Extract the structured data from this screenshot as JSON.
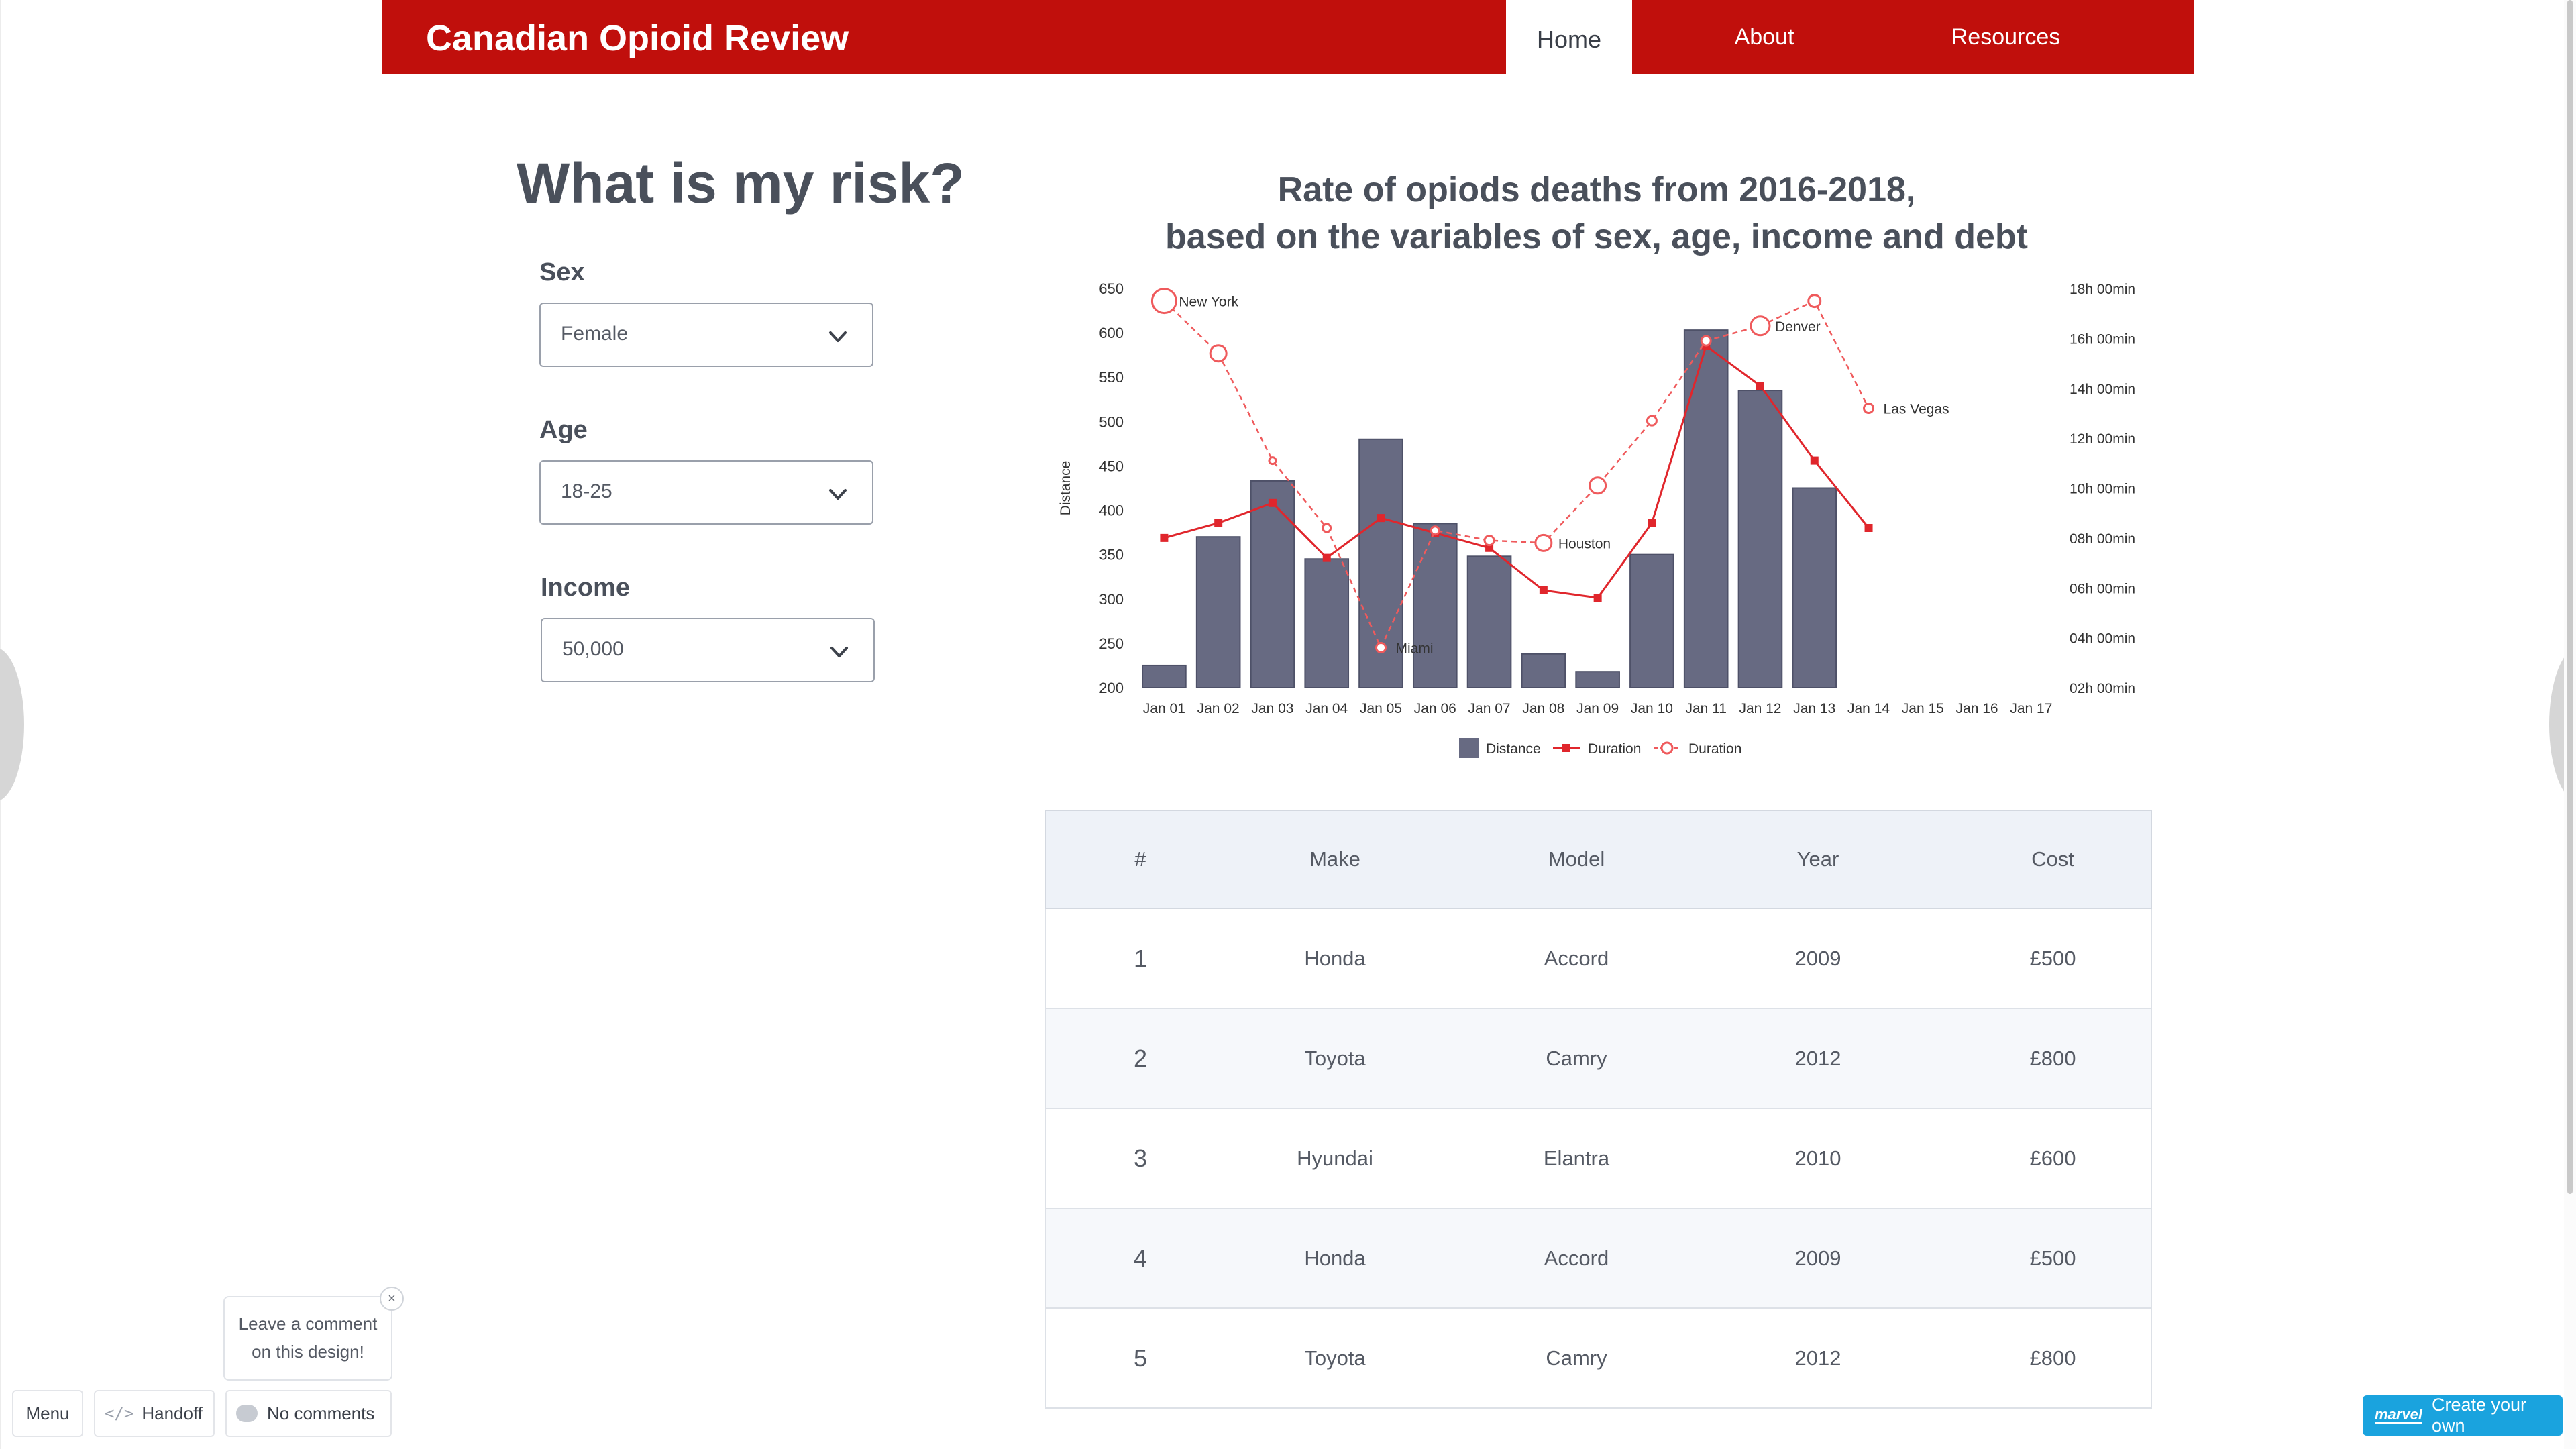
{
  "header": {
    "brand": "Canadian Opioid Review",
    "nav": {
      "home": "Home",
      "about": "About",
      "resources": "Resources"
    }
  },
  "form": {
    "title": "What is my risk?",
    "fields": [
      {
        "label": "Sex",
        "value": "Female"
      },
      {
        "label": "Age",
        "value": "18-25"
      },
      {
        "label": "Income",
        "value": "50,000"
      }
    ]
  },
  "chart_title_lines": [
    "Rate of opiods deaths from 2016-2018,",
    "based on the variables of sex, age, income and debt"
  ],
  "chart_data": {
    "type": "bar",
    "title": "Rate of opiods deaths from 2016-2018, based on the variables of sex, age, income and debt",
    "categories": [
      "Jan 01",
      "Jan 02",
      "Jan 03",
      "Jan 04",
      "Jan 05",
      "Jan 06",
      "Jan 07",
      "Jan 08",
      "Jan 09",
      "Jan 10",
      "Jan 11",
      "Jan 12",
      "Jan 13",
      "Jan 14",
      "Jan 15",
      "Jan 16",
      "Jan 17"
    ],
    "ylabel": "Distance",
    "y2label": "Duration",
    "ylim": [
      200,
      650
    ],
    "yticks": [
      200,
      250,
      300,
      350,
      400,
      450,
      500,
      550,
      600,
      650
    ],
    "y2ticks": [
      "02h 00min",
      "04h 00min",
      "06h 00min",
      "08h 00min",
      "10h 00min",
      "12h 00min",
      "14h 00min",
      "16h 00min",
      "18h 00min"
    ],
    "y2lim": [
      2,
      18
    ],
    "series": [
      {
        "name": "Distance",
        "kind": "bar",
        "color": "#676a82",
        "values": [
          225,
          370,
          433,
          345,
          480,
          385,
          348,
          238,
          218,
          350,
          603,
          535,
          425,
          null,
          null,
          null,
          null
        ]
      },
      {
        "name": "Duration",
        "kind": "line-solid",
        "color": "#e0262c",
        "values": [
          8.0,
          8.6,
          9.4,
          7.2,
          8.8,
          8.2,
          7.6,
          5.9,
          5.6,
          8.6,
          15.7,
          14.1,
          11.1,
          8.4,
          null,
          null,
          null
        ]
      },
      {
        "name": "Duration",
        "kind": "line-dashed",
        "color": "#ef5a5c",
        "values": [
          17.5,
          15.4,
          11.1,
          8.4,
          3.6,
          8.3,
          7.9,
          7.8,
          10.1,
          12.7,
          15.9,
          16.5,
          17.5,
          13.2,
          null,
          null,
          null
        ]
      }
    ],
    "annotations": [
      {
        "text": "New York",
        "series": 2,
        "index": 0
      },
      {
        "text": "Miami",
        "series": 2,
        "index": 4
      },
      {
        "text": "Houston",
        "series": 2,
        "index": 7
      },
      {
        "text": "Denver",
        "series": 2,
        "index": 11
      },
      {
        "text": "Las Vegas",
        "series": 2,
        "index": 13
      }
    ],
    "legend": [
      "Distance",
      "Duration",
      "Duration"
    ],
    "legend_position": "bottom"
  },
  "table": {
    "headers": [
      "#",
      "Make",
      "Model",
      "Year",
      "Cost"
    ],
    "rows": [
      [
        "1",
        "Honda",
        "Accord",
        "2009",
        "£500"
      ],
      [
        "2",
        "Toyota",
        "Camry",
        "2012",
        "£800"
      ],
      [
        "3",
        "Hyundai",
        "Elantra",
        "2010",
        "£600"
      ],
      [
        "4",
        "Honda",
        "Accord",
        "2009",
        "£500"
      ],
      [
        "5",
        "Toyota",
        "Camry",
        "2012",
        "£800"
      ]
    ]
  },
  "footer": {
    "menu": "Menu",
    "handoff": "Handoff",
    "comments": "No comments",
    "tooltip_line1": "Leave a comment",
    "tooltip_line2": "on this design!",
    "tooltip_close": "×",
    "cta_logo": "marvel",
    "cta": "Create your own"
  }
}
